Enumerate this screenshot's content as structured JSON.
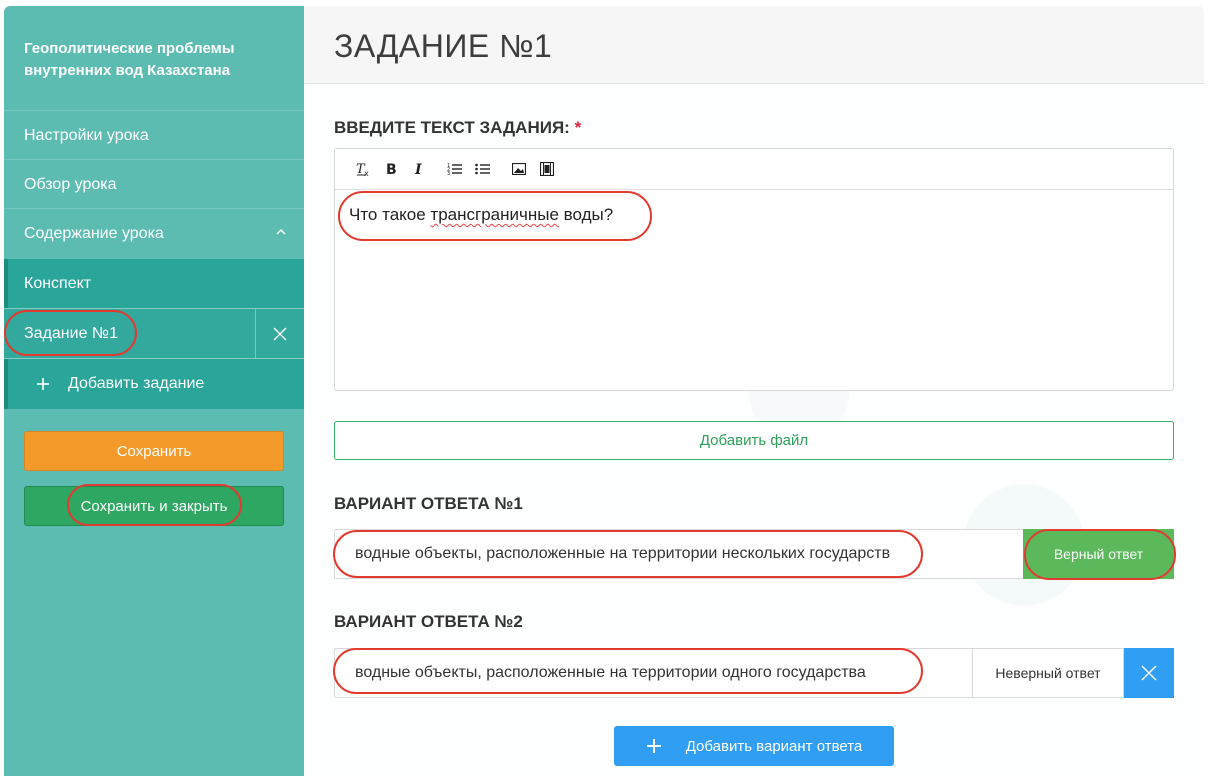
{
  "sidebar": {
    "course_title": "Геополитические проблемы внутренних вод Казахстана",
    "items": [
      {
        "label": "Настройки урока"
      },
      {
        "label": "Обзор урока"
      },
      {
        "label": "Содержание урока"
      }
    ],
    "sub_items": [
      {
        "label": "Конспект"
      },
      {
        "label": "Задание №1"
      }
    ],
    "add_task_label": "Добавить задание",
    "save_label": "Сохранить",
    "save_close_label": "Сохранить и закрыть"
  },
  "main": {
    "title": "ЗАДАНИЕ №1",
    "task_label": "ВВЕДИТЕ ТЕКСТ ЗАДАНИЯ:",
    "required_mark": "*",
    "editor": {
      "text_before": "Что такое ",
      "text_misspelled": "трансграничные",
      "text_after": " воды?",
      "toolbar": [
        "remove-format-icon",
        "bold-icon",
        "italic-icon",
        "numbered-list-icon",
        "bullet-list-icon",
        "image-icon",
        "video-icon"
      ]
    },
    "add_file_label": "Добавить файл",
    "answers": [
      {
        "heading": "ВАРИАНТ ОТВЕТА №1",
        "text": "водные объекты, расположенные на территории нескольких государств",
        "status_label": "Верный ответ"
      },
      {
        "heading": "ВАРИАНТ ОТВЕТА №2",
        "text": "водные объекты, расположенные на территории одного государства",
        "status_label": "Неверный ответ"
      }
    ],
    "add_answer_label": "Добавить вариант ответа"
  },
  "colors": {
    "sidebar": "#5cbcb1",
    "sidebar_active": "#2aa59a",
    "save": "#f39a2a",
    "save_close": "#2ea763",
    "correct": "#5bb85b",
    "primary": "#2f9ef3",
    "annotation": "#e23a2e"
  }
}
